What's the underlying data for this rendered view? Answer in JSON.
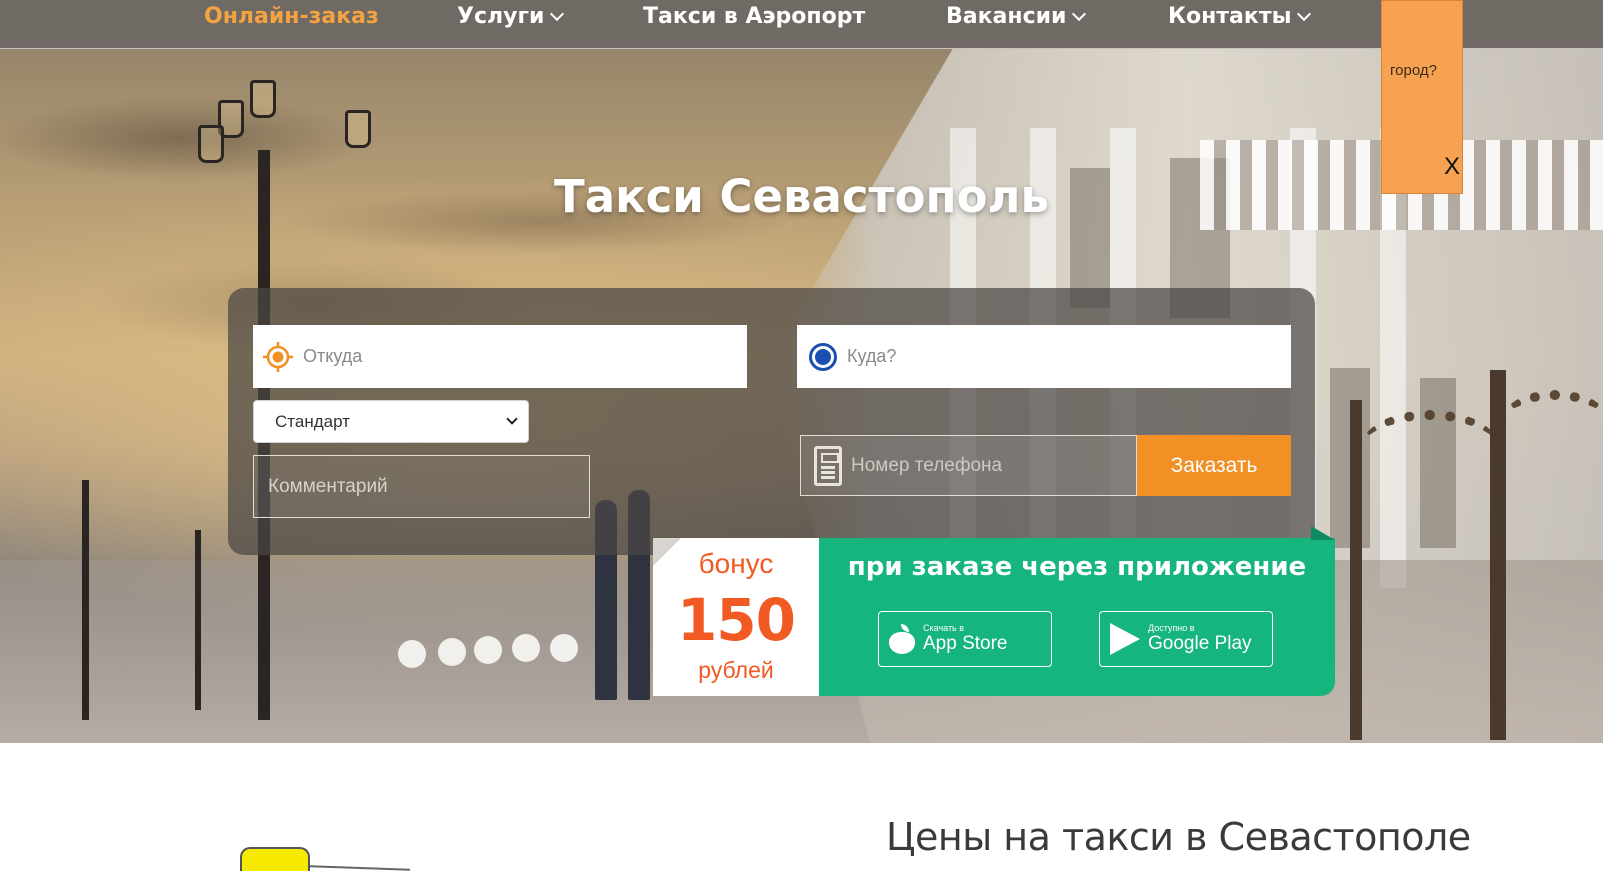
{
  "nav": {
    "items": [
      {
        "label": "Онлайн-заказ",
        "active": true,
        "dropdown": false
      },
      {
        "label": "Услуги",
        "active": false,
        "dropdown": true
      },
      {
        "label": "Такси в Аэропорт",
        "active": false,
        "dropdown": false
      },
      {
        "label": "Вакансии",
        "active": false,
        "dropdown": true
      },
      {
        "label": "Контакты",
        "active": false,
        "dropdown": true
      }
    ]
  },
  "city_popup": {
    "question": "город?",
    "close": "X"
  },
  "hero": {
    "title": "Такси Севастополь"
  },
  "form": {
    "from_placeholder": "Откуда",
    "to_placeholder": "Куда?",
    "class_selected": "Стандарт",
    "comment_placeholder": "Комментарий",
    "phone_placeholder": "Номер телефона",
    "order_button": "Заказать"
  },
  "bonus": {
    "word": "бонус",
    "amount": "150",
    "unit": "рублей",
    "headline": "при заказе через приложение",
    "appstore_small": "Скачать в",
    "appstore_big": "App Store",
    "gplay_small": "Доступно в",
    "gplay_big": "Google Play"
  },
  "section": {
    "title": "Цены на такси в Севастополе"
  },
  "colors": {
    "accent_orange": "#f28f25",
    "active_nav": "#f4a340",
    "bonus_green": "#16b57e",
    "bonus_red": "#f25a23",
    "popup_orange": "#f7a250",
    "to_marker_blue": "#1a4fb0"
  },
  "icons": {
    "from": "location-target-icon",
    "to": "radio-dot-icon",
    "phone": "calculator-phone-icon",
    "appstore": "apple-icon",
    "gplay": "google-play-icon"
  }
}
